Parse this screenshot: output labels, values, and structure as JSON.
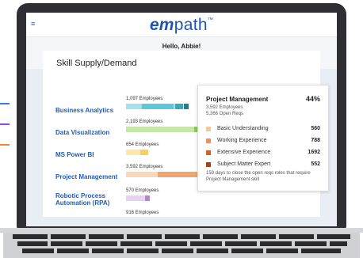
{
  "app": {
    "logo_bold": "em",
    "logo_light": "path",
    "logo_tm": "™",
    "greeting": "Hello, Abbie!",
    "menu_icon": "≡"
  },
  "panel": {
    "title": "Skill Supply/Demand",
    "skills": [
      {
        "name": "Business Analytics",
        "employees": "1,097 Employees"
      },
      {
        "name": "Data Visualization",
        "employees": "2,193 Employees"
      },
      {
        "name": "MS Power BI",
        "employees": "654 Employees"
      },
      {
        "name": "Project Management",
        "employees": "3,592 Employees"
      },
      {
        "name": "Robotic Process Automation (RPA)",
        "employees": "570 Employees"
      },
      {
        "name": "",
        "employees": "916 Employees"
      }
    ]
  },
  "tooltip": {
    "title": "Project Management",
    "percent": "44%",
    "employees": "3,592 Employees",
    "open_reqs": "5,366 Open Reqs",
    "rows": [
      {
        "label": "Basic Understanding",
        "value": "560",
        "color": "#f2c79a"
      },
      {
        "label": "Working Experience",
        "value": "788",
        "color": "#e7935a"
      },
      {
        "label": "Extensive Experience",
        "value": "1692",
        "color": "#d2602b"
      },
      {
        "label": "Subject Matter Expert",
        "value": "552",
        "color": "#a7401c"
      }
    ],
    "footer": "159 days to close the open reqs roles that require Project Management skill"
  },
  "colors": {
    "brand": "#1f54b7",
    "skill_text": "#1f5bb8",
    "mark_blue": "#2f7fe0",
    "mark_purple": "#8d4bd9",
    "mark_orange": "#f28a2b"
  }
}
